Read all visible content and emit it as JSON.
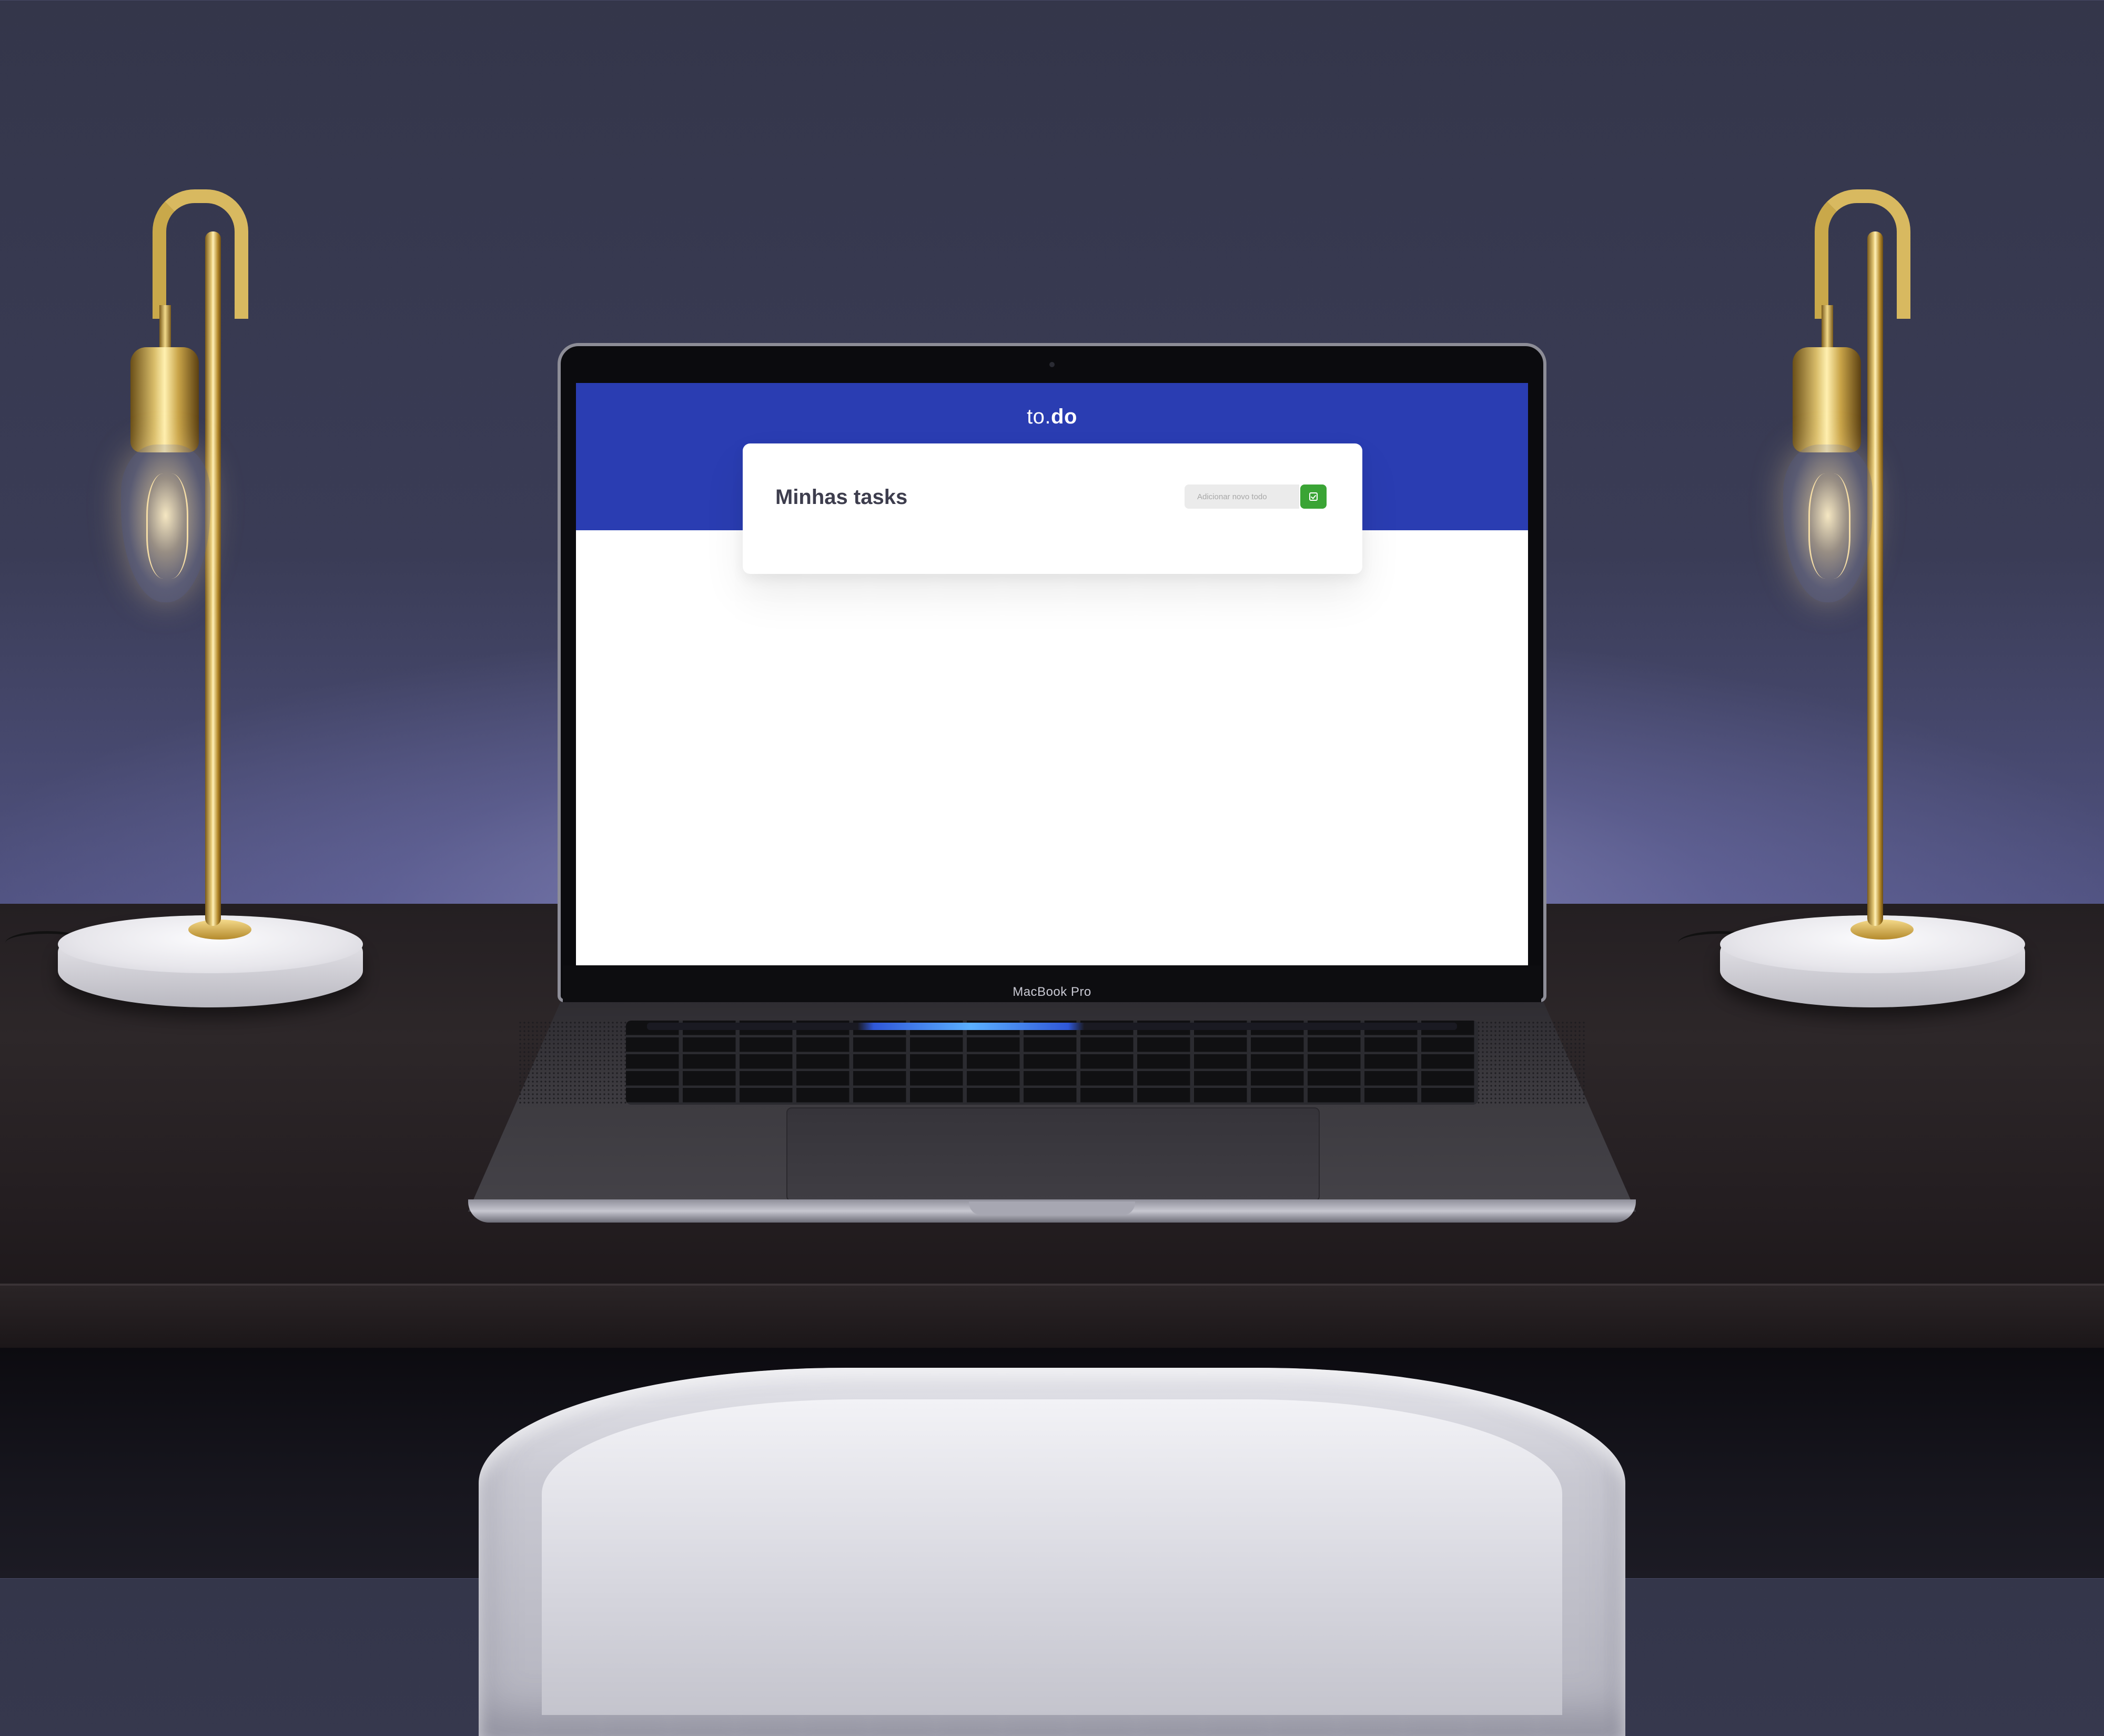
{
  "app": {
    "logo_prefix": "to.",
    "logo_suffix": "do",
    "card_title": "Minhas tasks",
    "new_task_placeholder": "Adicionar novo todo",
    "add_button_icon": "check-square-icon",
    "colors": {
      "header": "#2a3db2",
      "add_button": "#3aa435"
    }
  },
  "device": {
    "brand_label": "MacBook Pro"
  }
}
